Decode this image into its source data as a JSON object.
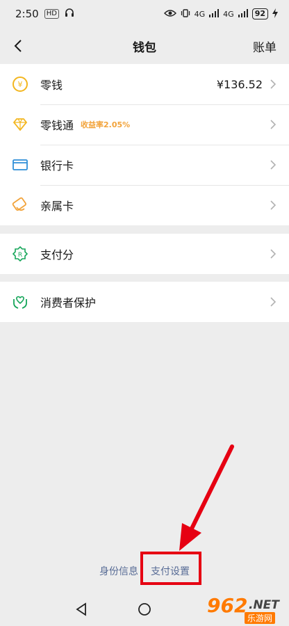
{
  "status_bar": {
    "time": "2:50",
    "mini_badge": "HD",
    "network_1": "4G",
    "network_2": "4G",
    "battery": "92"
  },
  "nav": {
    "title": "钱包",
    "right_label": "账单"
  },
  "wallet_items": [
    {
      "label": "零钱",
      "value": "¥136.52",
      "icon": "yuan-coin-icon"
    },
    {
      "label": "零钱通",
      "tag": "收益率2.05%",
      "icon": "diamond-icon"
    },
    {
      "label": "银行卡",
      "icon": "bank-card-icon"
    },
    {
      "label": "亲属卡",
      "icon": "family-card-icon"
    }
  ],
  "credit_item": {
    "label": "支付分",
    "icon": "pay-score-badge-icon"
  },
  "protection_item": {
    "label": "消费者保护",
    "icon": "consumer-protection-icon"
  },
  "footer": {
    "identity_label": "身份信息",
    "settings_label": "支付设置"
  },
  "watermark": {
    "number": "962",
    "domain": ".NET",
    "cn_text": "乐游网"
  },
  "colors": {
    "yellow_icon": "#f3b61f",
    "blue_icon": "#2f8fd8",
    "orange_icon": "#f2a33a",
    "green_icon": "#16a65a",
    "highlight": "#e60012",
    "link": "#576b95"
  }
}
